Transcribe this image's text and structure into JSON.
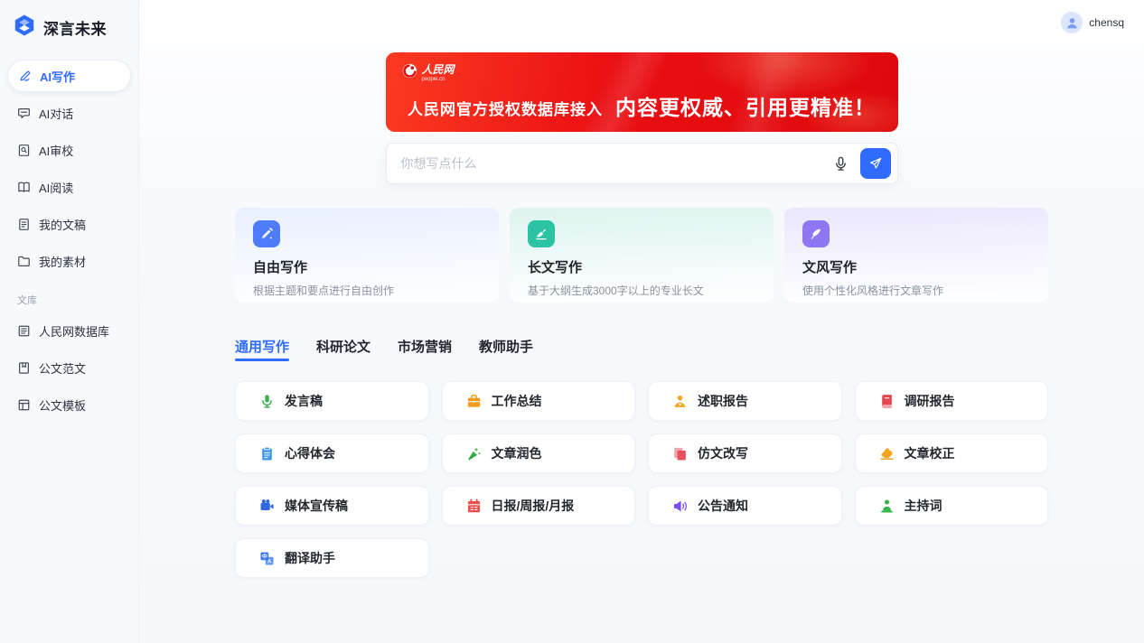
{
  "app": {
    "name": "深言未来",
    "user": "chensq"
  },
  "colors": {
    "primary_blue": "#2e6bfe",
    "banner_red": "#e70d11",
    "sidebar_bg": "#f7f9fb"
  },
  "sidebar": {
    "items": [
      {
        "label": "AI写作",
        "icon": "pen-icon",
        "active": true
      },
      {
        "label": "AI对话",
        "icon": "chat-icon"
      },
      {
        "label": "AI审校",
        "icon": "doc-search-icon"
      },
      {
        "label": "AI阅读",
        "icon": "open-book-icon"
      },
      {
        "label": "我的文稿",
        "icon": "doc-icon"
      },
      {
        "label": "我的素材",
        "icon": "folder-icon"
      }
    ],
    "section_label": "文库",
    "library_items": [
      {
        "label": "人民网数据库",
        "icon": "newspaper-icon"
      },
      {
        "label": "公文范文",
        "icon": "doc-bookmark-icon"
      },
      {
        "label": "公文模板",
        "icon": "template-icon"
      }
    ]
  },
  "banner": {
    "logo_text": "人民网",
    "logo_sub": "people.cn",
    "text_small": "人民网官方授权数据库接入",
    "text_large": "内容更权威、引用更精准！"
  },
  "composer": {
    "placeholder": "你想写点什么"
  },
  "feature_cards": [
    {
      "title": "自由写作",
      "desc": "根据主题和要点进行自由创作",
      "icon": "pencil-tile-icon",
      "icon_bg": "#4d7bf9",
      "bg_from": "#e8efff"
    },
    {
      "title": "长文写作",
      "desc": "基于大纲生成3000字以上的专业长文",
      "icon": "signature-tile-icon",
      "icon_bg": "#2cc2a4",
      "bg_from": "#ddf4ee"
    },
    {
      "title": "文风写作",
      "desc": "使用个性化风格进行文章写作",
      "icon": "quill-tile-icon",
      "icon_bg": "#8e77f3",
      "bg_from": "#ebe6fc"
    }
  ],
  "tabs": [
    {
      "label": "通用写作",
      "active": true
    },
    {
      "label": "科研论文"
    },
    {
      "label": "市场营销"
    },
    {
      "label": "教师助手"
    }
  ],
  "templates": {
    "items": [
      {
        "label": "发言稿",
        "icon": "mic-green-icon",
        "color": "#3fae53"
      },
      {
        "label": "工作总结",
        "icon": "briefcase-icon",
        "color": "#f29b1d"
      },
      {
        "label": "述职报告",
        "icon": "person-badge-icon",
        "color": "#f5a623"
      },
      {
        "label": "调研报告",
        "icon": "book-red-icon",
        "color": "#e5484d"
      },
      {
        "label": "心得体会",
        "icon": "clipboard-icon",
        "color": "#3e97ee"
      },
      {
        "label": "文章润色",
        "icon": "wand-icon",
        "color": "#3aab44"
      },
      {
        "label": "仿文改写",
        "icon": "copy-icon",
        "color": "#e8505b"
      },
      {
        "label": "文章校正",
        "icon": "eraser-icon",
        "color": "#f2a51f"
      },
      {
        "label": "媒体宣传稿",
        "icon": "camera-icon",
        "color": "#2f68e0"
      },
      {
        "label": "日报/周报/月报",
        "icon": "calendar-icon",
        "color": "#ee4d4d"
      },
      {
        "label": "公告通知",
        "icon": "megaphone-icon",
        "color": "#7c4dee"
      },
      {
        "label": "主持词",
        "icon": "host-icon",
        "color": "#36b44a"
      },
      {
        "label": "翻译助手",
        "icon": "translate-icon",
        "color": "#3f7bf0"
      }
    ]
  }
}
